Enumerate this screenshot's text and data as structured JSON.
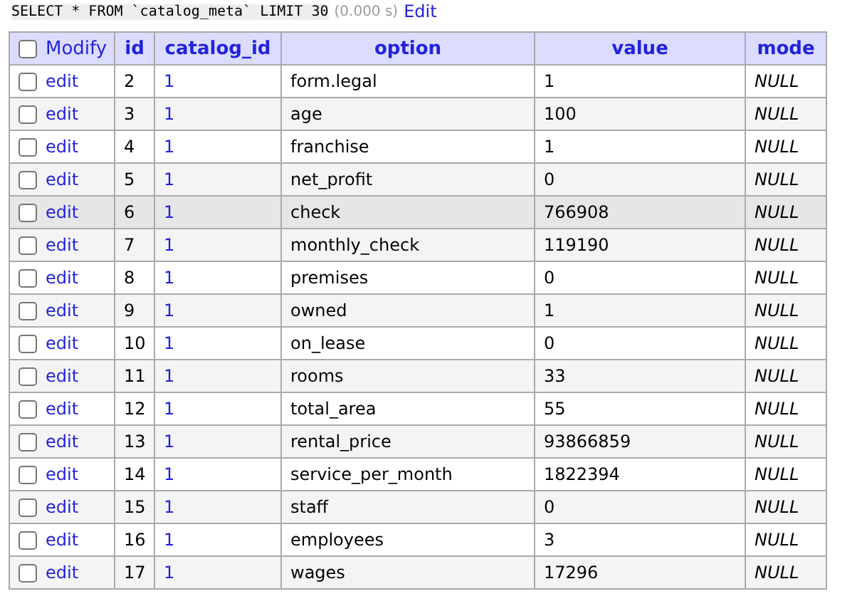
{
  "query": {
    "sql": "SELECT * FROM `catalog_meta` LIMIT 30",
    "time": "(0.000 s)",
    "edit_link": "Edit"
  },
  "table": {
    "select_all": {
      "checked": false
    },
    "columns": [
      "Modify",
      "id",
      "catalog_id",
      "option",
      "value",
      "mode"
    ],
    "rows": [
      {
        "checked": false,
        "hovered": false,
        "edit": "edit",
        "id": "2",
        "catalog_id": "1",
        "option": "form.legal",
        "value": "1",
        "mode": "NULL"
      },
      {
        "checked": false,
        "hovered": false,
        "edit": "edit",
        "id": "3",
        "catalog_id": "1",
        "option": "age",
        "value": "100",
        "mode": "NULL"
      },
      {
        "checked": false,
        "hovered": false,
        "edit": "edit",
        "id": "4",
        "catalog_id": "1",
        "option": "franchise",
        "value": "1",
        "mode": "NULL"
      },
      {
        "checked": false,
        "hovered": false,
        "edit": "edit",
        "id": "5",
        "catalog_id": "1",
        "option": "net_profit",
        "value": "0",
        "mode": "NULL"
      },
      {
        "checked": false,
        "hovered": true,
        "edit": "edit",
        "id": "6",
        "catalog_id": "1",
        "option": "check",
        "value": "766908",
        "mode": "NULL"
      },
      {
        "checked": false,
        "hovered": false,
        "edit": "edit",
        "id": "7",
        "catalog_id": "1",
        "option": "monthly_check",
        "value": "119190",
        "mode": "NULL"
      },
      {
        "checked": false,
        "hovered": false,
        "edit": "edit",
        "id": "8",
        "catalog_id": "1",
        "option": "premises",
        "value": "0",
        "mode": "NULL"
      },
      {
        "checked": false,
        "hovered": false,
        "edit": "edit",
        "id": "9",
        "catalog_id": "1",
        "option": "owned",
        "value": "1",
        "mode": "NULL"
      },
      {
        "checked": false,
        "hovered": false,
        "edit": "edit",
        "id": "10",
        "catalog_id": "1",
        "option": "on_lease",
        "value": "0",
        "mode": "NULL"
      },
      {
        "checked": false,
        "hovered": false,
        "edit": "edit",
        "id": "11",
        "catalog_id": "1",
        "option": "rooms",
        "value": "33",
        "mode": "NULL"
      },
      {
        "checked": false,
        "hovered": false,
        "edit": "edit",
        "id": "12",
        "catalog_id": "1",
        "option": "total_area",
        "value": "55",
        "mode": "NULL"
      },
      {
        "checked": false,
        "hovered": false,
        "edit": "edit",
        "id": "13",
        "catalog_id": "1",
        "option": "rental_price",
        "value": "93866859",
        "mode": "NULL"
      },
      {
        "checked": false,
        "hovered": false,
        "edit": "edit",
        "id": "14",
        "catalog_id": "1",
        "option": "service_per_month",
        "value": "1822394",
        "mode": "NULL"
      },
      {
        "checked": false,
        "hovered": false,
        "edit": "edit",
        "id": "15",
        "catalog_id": "1",
        "option": "staff",
        "value": "0",
        "mode": "NULL"
      },
      {
        "checked": false,
        "hovered": false,
        "edit": "edit",
        "id": "16",
        "catalog_id": "1",
        "option": "employees",
        "value": "3",
        "mode": "NULL"
      },
      {
        "checked": false,
        "hovered": false,
        "edit": "edit",
        "id": "17",
        "catalog_id": "1",
        "option": "wages",
        "value": "17296",
        "mode": "NULL"
      }
    ]
  }
}
